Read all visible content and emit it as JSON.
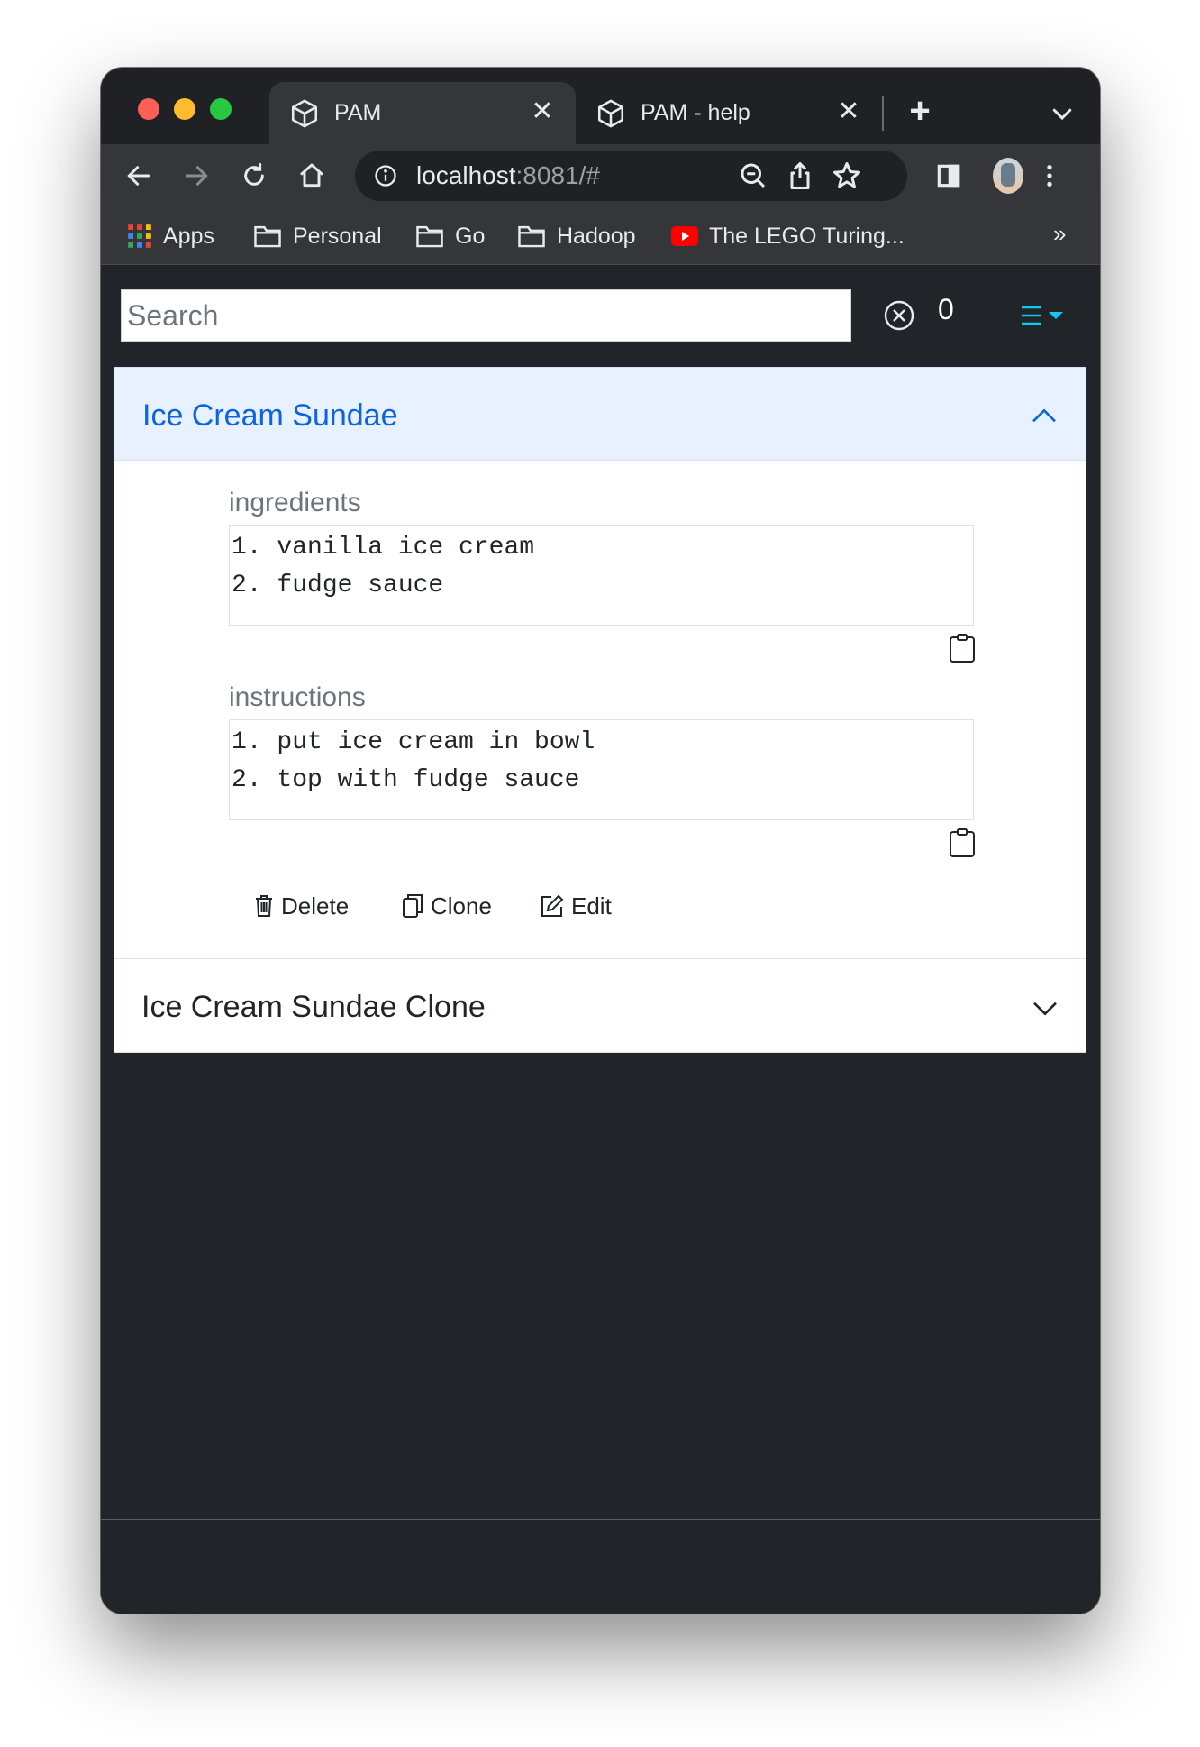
{
  "browser": {
    "tabs": [
      {
        "title": "PAM",
        "active": true
      },
      {
        "title": "PAM - help",
        "active": false
      }
    ],
    "new_tab_symbol": "+",
    "tab_close_symbol": "✕",
    "url_host": "localhost",
    "url_rest": ":8081/#",
    "bookmarks": [
      {
        "label": "Apps",
        "icon": "apps-grid-icon"
      },
      {
        "label": "Personal",
        "icon": "folder-icon"
      },
      {
        "label": "Go",
        "icon": "folder-icon"
      },
      {
        "label": "Hadoop",
        "icon": "folder-icon"
      },
      {
        "label": "The LEGO Turing...",
        "icon": "youtube-icon"
      }
    ],
    "bookmarks_more": "»"
  },
  "navbar": {
    "search_placeholder": "Search",
    "count": "0"
  },
  "entries": [
    {
      "title": "Ice Cream Sundae",
      "expanded": true,
      "fields": [
        {
          "label": "ingredients",
          "lines": [
            "1. vanilla ice cream",
            "2. fudge sauce"
          ]
        },
        {
          "label": "instructions",
          "lines": [
            "1. put ice cream in bowl",
            "2. top with fudge sauce"
          ]
        }
      ],
      "actions": {
        "delete": "Delete",
        "clone": "Clone",
        "edit": "Edit"
      }
    },
    {
      "title": "Ice Cream Sundae Clone",
      "expanded": false
    }
  ],
  "colors": {
    "accent_blue": "#0c63e4",
    "menu_icon": "#0dcaf0",
    "page_bg": "#212529"
  }
}
